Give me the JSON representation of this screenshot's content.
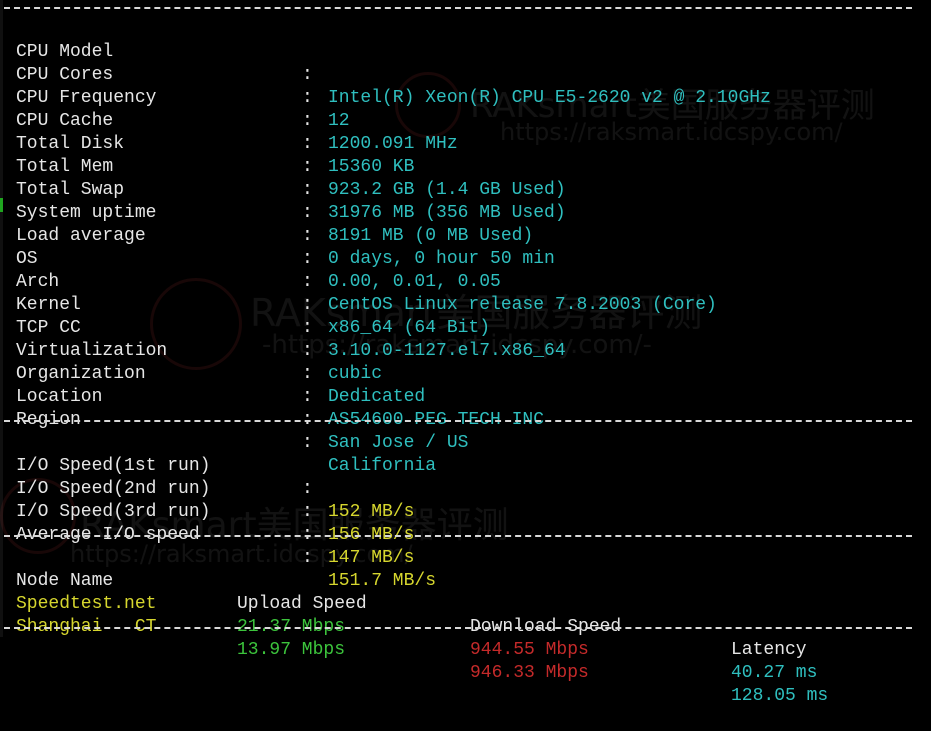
{
  "system": [
    {
      "label": "CPU Model",
      "value": "Intel(R) Xeon(R) CPU E5-2620 v2 @ 2.10GHz"
    },
    {
      "label": "CPU Cores",
      "value": "12"
    },
    {
      "label": "CPU Frequency",
      "value": "1200.091 MHz"
    },
    {
      "label": "CPU Cache",
      "value": "15360 KB"
    },
    {
      "label": "Total Disk",
      "value": "923.2 GB (1.4 GB Used)"
    },
    {
      "label": "Total Mem",
      "value": "31976 MB (356 MB Used)"
    },
    {
      "label": "Total Swap",
      "value": "8191 MB (0 MB Used)"
    },
    {
      "label": "System uptime",
      "value": "0 days, 0 hour 50 min"
    },
    {
      "label": "Load average",
      "value": "0.00, 0.01, 0.05"
    },
    {
      "label": "OS",
      "value": "CentOS Linux release 7.8.2003 (Core)"
    },
    {
      "label": "Arch",
      "value": "x86_64 (64 Bit)"
    },
    {
      "label": "Kernel",
      "value": "3.10.0-1127.el7.x86_64"
    },
    {
      "label": "TCP CC",
      "value": "cubic"
    },
    {
      "label": "Virtualization",
      "value": "Dedicated"
    },
    {
      "label": "Organization",
      "value": "AS54600 PEG TECH INC"
    },
    {
      "label": "Location",
      "value": "San Jose / US"
    },
    {
      "label": "Region",
      "value": "California"
    }
  ],
  "io": [
    {
      "label": "I/O Speed(1st run)",
      "value": "152 MB/s"
    },
    {
      "label": "I/O Speed(2nd run)",
      "value": "156 MB/s"
    },
    {
      "label": "I/O Speed(3rd run)",
      "value": "147 MB/s"
    },
    {
      "label": "Average I/O speed",
      "value": "151.7 MB/s"
    }
  ],
  "speedtest": {
    "headers": {
      "node": "Node Name",
      "upload": "Upload Speed",
      "download": "Download Speed",
      "latency": "Latency"
    },
    "rows": [
      {
        "node": "Speedtest.net",
        "upload": "21.37 Mbps",
        "download": "944.55 Mbps",
        "latency": "40.27 ms"
      },
      {
        "node": "Shanghai   CT",
        "upload": "13.97 Mbps",
        "download": "946.33 Mbps",
        "latency": "128.05 ms"
      }
    ]
  },
  "separator": ":",
  "watermark": {
    "brand": "RAKsmart美国服务器评测",
    "url": "https://raksmart.idcspy.com/",
    "url_framed": "-https://raksmart.idcspy.com/-"
  },
  "colors": {
    "background": "#000000",
    "label": "#e6e6e6",
    "value_cyan": "#2fbfbf",
    "value_yellow": "#d6d62e",
    "upload_green": "#3cc43c",
    "download_red": "#c42a2a"
  }
}
